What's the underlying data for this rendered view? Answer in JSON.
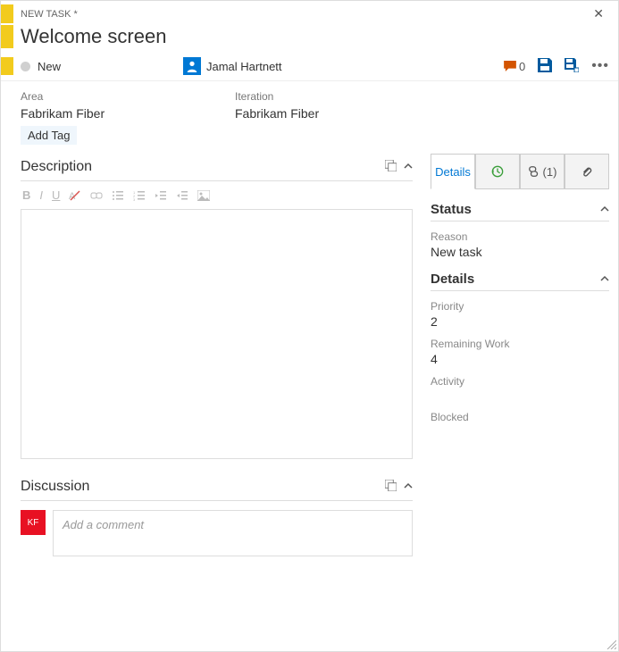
{
  "header": {
    "type_label": "NEW TASK *"
  },
  "title": "Welcome screen",
  "state": "New",
  "assignee": "Jamal Hartnett",
  "comment_count": "0",
  "area": {
    "label": "Area",
    "value": "Fabrikam Fiber"
  },
  "iteration": {
    "label": "Iteration",
    "value": "Fabrikam Fiber"
  },
  "add_tag_label": "Add Tag",
  "description_title": "Description",
  "discussion_title": "Discussion",
  "comment_placeholder": "Add a comment",
  "discussion_avatar_initials": "KF",
  "tabs": {
    "details": "Details",
    "links": "(1)"
  },
  "status_section": {
    "title": "Status",
    "reason_label": "Reason",
    "reason_value": "New task"
  },
  "details_section": {
    "title": "Details",
    "priority_label": "Priority",
    "priority_value": "2",
    "remaining_label": "Remaining Work",
    "remaining_value": "4",
    "activity_label": "Activity",
    "blocked_label": "Blocked"
  }
}
